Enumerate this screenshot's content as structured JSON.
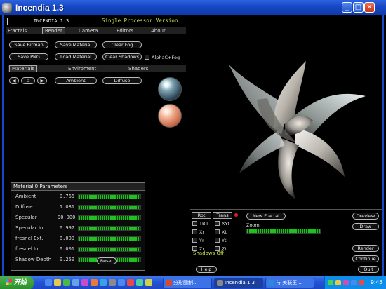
{
  "window": {
    "title": "Incendia 1.3",
    "min_glyph": "_",
    "max_glyph": "□",
    "close_glyph": "✕"
  },
  "header": {
    "app_label": "INCENDIA 1.3",
    "version_text": "Single Processor Version"
  },
  "menu": [
    "Fractals",
    "Render",
    "Camera",
    "Editors",
    "About"
  ],
  "active_menu": "Render",
  "buttons": {
    "save_bitmap": "Save Bitmap",
    "save_material": "Save Material",
    "clear_fog": "Clear Fog",
    "save_png": "Save PNG",
    "load_material": "Load Material",
    "clear_shadows": "Clear Shadows",
    "alphac_fog": "AlphaC+Fog"
  },
  "subtabs": [
    "Materials",
    "Enviroment",
    "Shaders"
  ],
  "material": {
    "prev": "◀",
    "index": "0",
    "next": "▶",
    "ambient_label": "Ambient",
    "diffuse_label": "Diffuse"
  },
  "params": {
    "title": "Material 0  Parameters",
    "rows": [
      {
        "label": "Ambient",
        "value": "0.766",
        "level": 0.766
      },
      {
        "label": "Diffuse",
        "value": "1.081",
        "level": 1.0
      },
      {
        "label": "Specular",
        "value": "90.000",
        "level": 1.0
      },
      {
        "label": "Specular Int.",
        "value": "0.997",
        "level": 0.997
      },
      {
        "label": "fresnel Ext.",
        "value": "8.000",
        "level": 1.0
      },
      {
        "label": "fresnel Int.",
        "value": "0.001",
        "level": 1.0
      },
      {
        "label": "Shadow Depth",
        "value": "0.250",
        "level": 1.0
      }
    ],
    "reset_label": "Reset"
  },
  "controls": {
    "rot_label": "Rot",
    "trans_label": "Trans",
    "rot_items": [
      "TBll",
      "Xr",
      "Yr",
      "Zr"
    ],
    "trans_items": [
      "XYt",
      "Xt",
      "Yt",
      "Zt"
    ],
    "new_fractal": "New Fractal",
    "zoom_label": "Zoom",
    "shadows_text": "Shadows Off",
    "help": "Help",
    "dreview": "Dreview",
    "draw": "Draw",
    "render": "Render",
    "continue": "Continue",
    "quit": "Quit"
  },
  "taskbar": {
    "start_label": "开始",
    "tasks": [
      {
        "label": "分形图制...",
        "color": "#d94a2a"
      },
      {
        "label": "Incendia 1.3",
        "color": "#888888"
      },
      {
        "label": "与 美联王...",
        "color": "#2a8ad9"
      }
    ],
    "clock": "9:45"
  }
}
